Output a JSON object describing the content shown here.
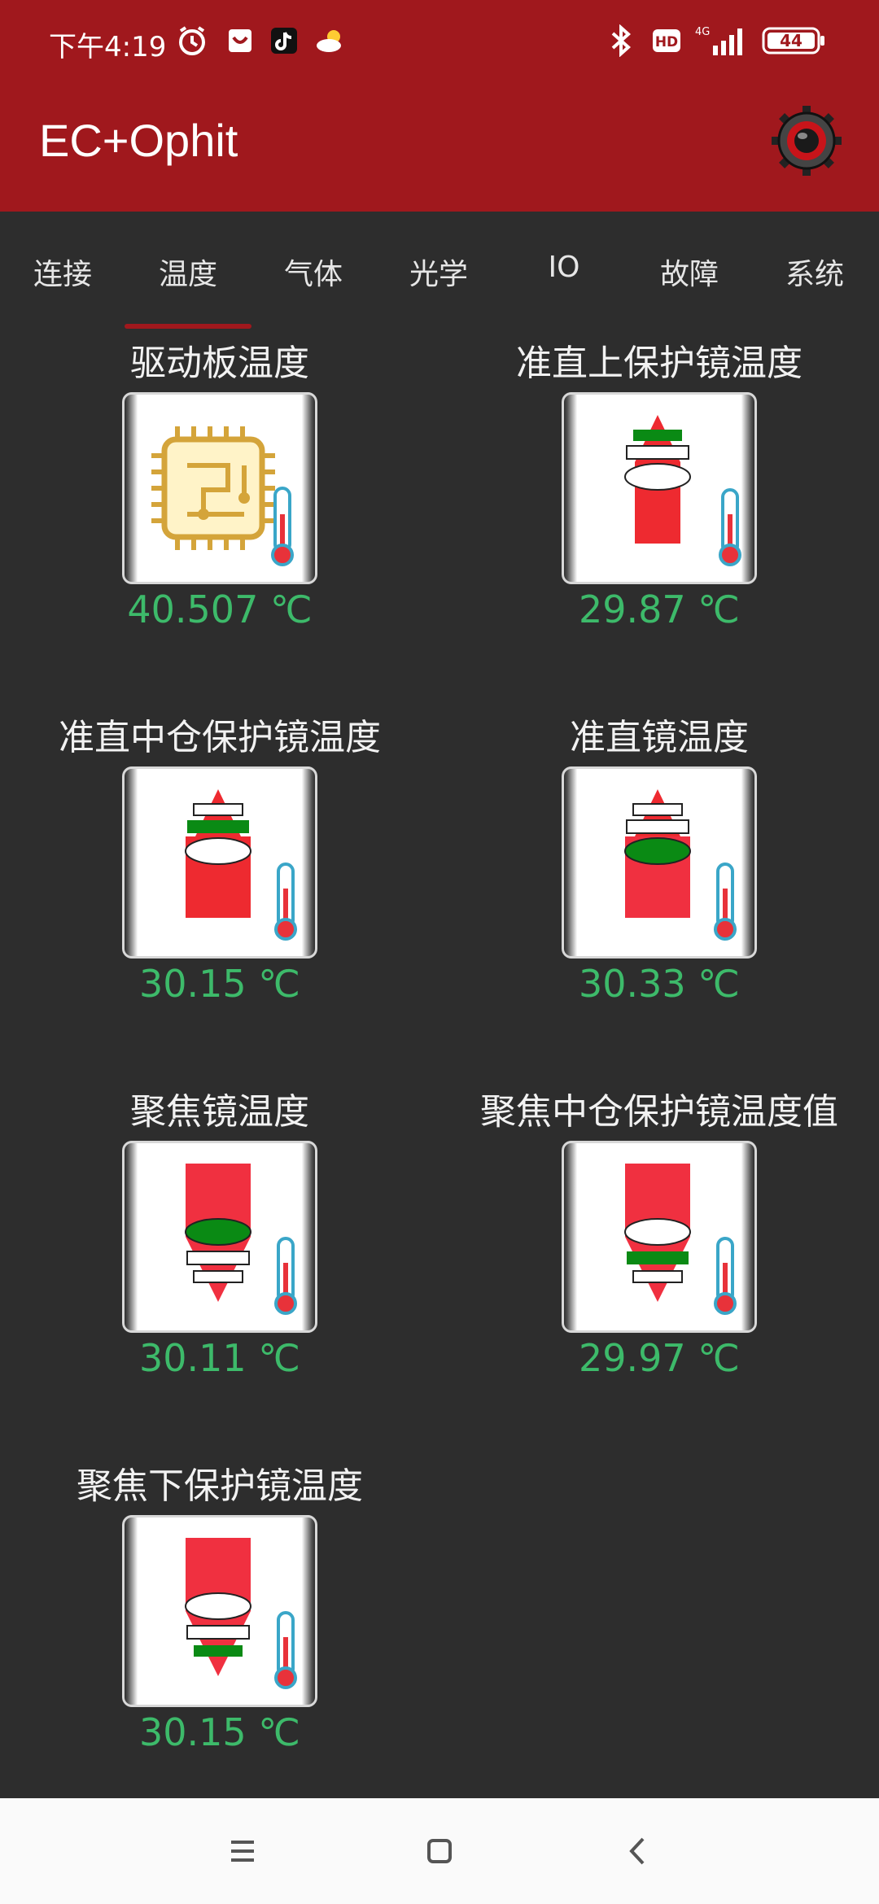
{
  "status_bar": {
    "time": "下午4:19",
    "battery": "44",
    "network": "4G",
    "hd": "HD"
  },
  "app": {
    "title": "EC+Ophit"
  },
  "tabs": [
    {
      "label": "连接"
    },
    {
      "label": "温度"
    },
    {
      "label": "气体"
    },
    {
      "label": "光学"
    },
    {
      "label": "IO"
    },
    {
      "label": "故障"
    },
    {
      "label": "系统"
    }
  ],
  "active_tab": "温度",
  "sensors": [
    {
      "title": "驱动板温度",
      "value": "40.507 ℃",
      "icon": "circuit-board-icon"
    },
    {
      "title": "准直上保护镜温度",
      "value": "29.87 ℃",
      "icon": "lens-top-icon"
    },
    {
      "title": "准直中仓保护镜温度",
      "value": "30.15 ℃",
      "icon": "lens-middle-icon"
    },
    {
      "title": "准直镜温度",
      "value": "30.33 ℃",
      "icon": "collimating-lens-icon"
    },
    {
      "title": "聚焦镜温度",
      "value": "30.11 ℃",
      "icon": "focusing-lens-icon"
    },
    {
      "title": "聚焦中仓保护镜温度值",
      "value": "29.97 ℃",
      "icon": "focus-middle-lens-icon"
    },
    {
      "title": "聚焦下保护镜温度",
      "value": "30.15 ℃",
      "icon": "focus-bottom-lens-icon"
    }
  ],
  "colors": {
    "accent": "#a0181d",
    "value_green": "#3dba6a",
    "background": "#2d2d2d",
    "lens_red": "#ee2a30",
    "lens_green": "#0a8a14"
  }
}
